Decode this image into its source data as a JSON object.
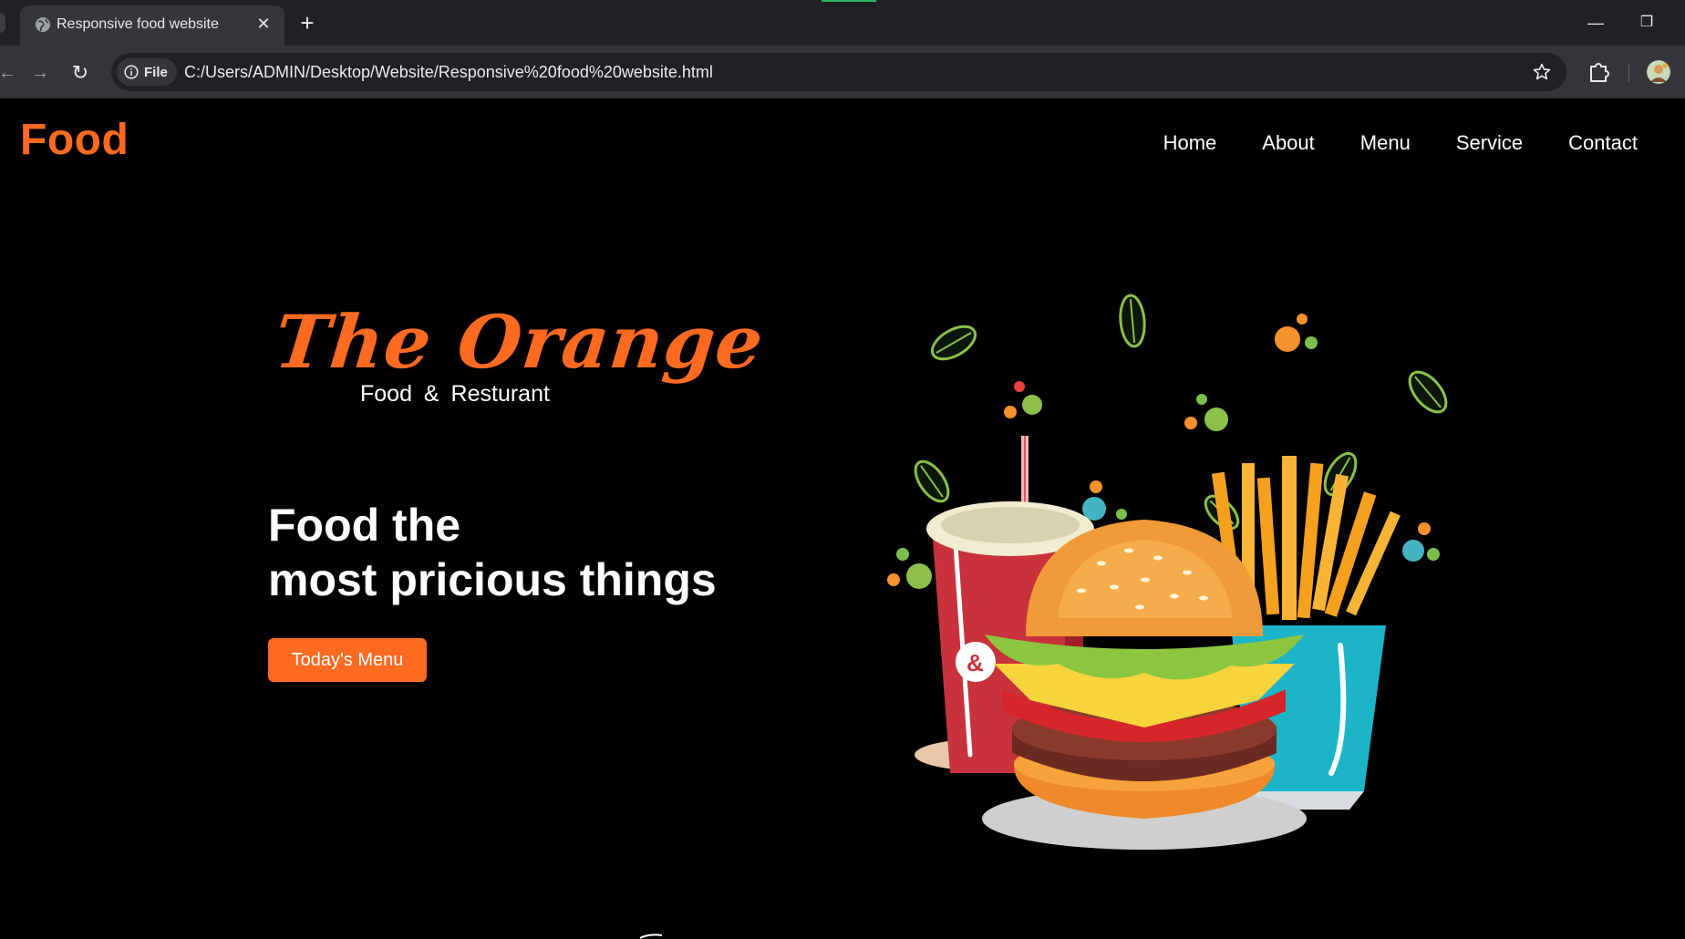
{
  "browser": {
    "tab_title": "Responsive food website",
    "close_glyph": "✕",
    "new_tab_glyph": "+",
    "file_chip_label": "File",
    "url": "C:/Users/ADMIN/Desktop/Website/Responsive%20food%20website.html",
    "minimize_glyph": "—",
    "restore_glyph": "❐",
    "back_glyph": "←",
    "forward_glyph": "→",
    "reload_glyph": "↻",
    "icons": [
      "globe-icon",
      "info-icon",
      "star-icon",
      "extensions-icon",
      "avatar"
    ]
  },
  "site": {
    "logo": "Food",
    "nav": [
      "Home",
      "About",
      "Menu",
      "Service",
      "Contact"
    ],
    "brand_title": "The Orange",
    "brand_subtitle": "Food & Resturant",
    "headline_line1": "Food the",
    "headline_line2": "most pricious things",
    "cta_label": "Today's Menu",
    "accent_color": "#ff6a21",
    "background_color": "#000000"
  }
}
